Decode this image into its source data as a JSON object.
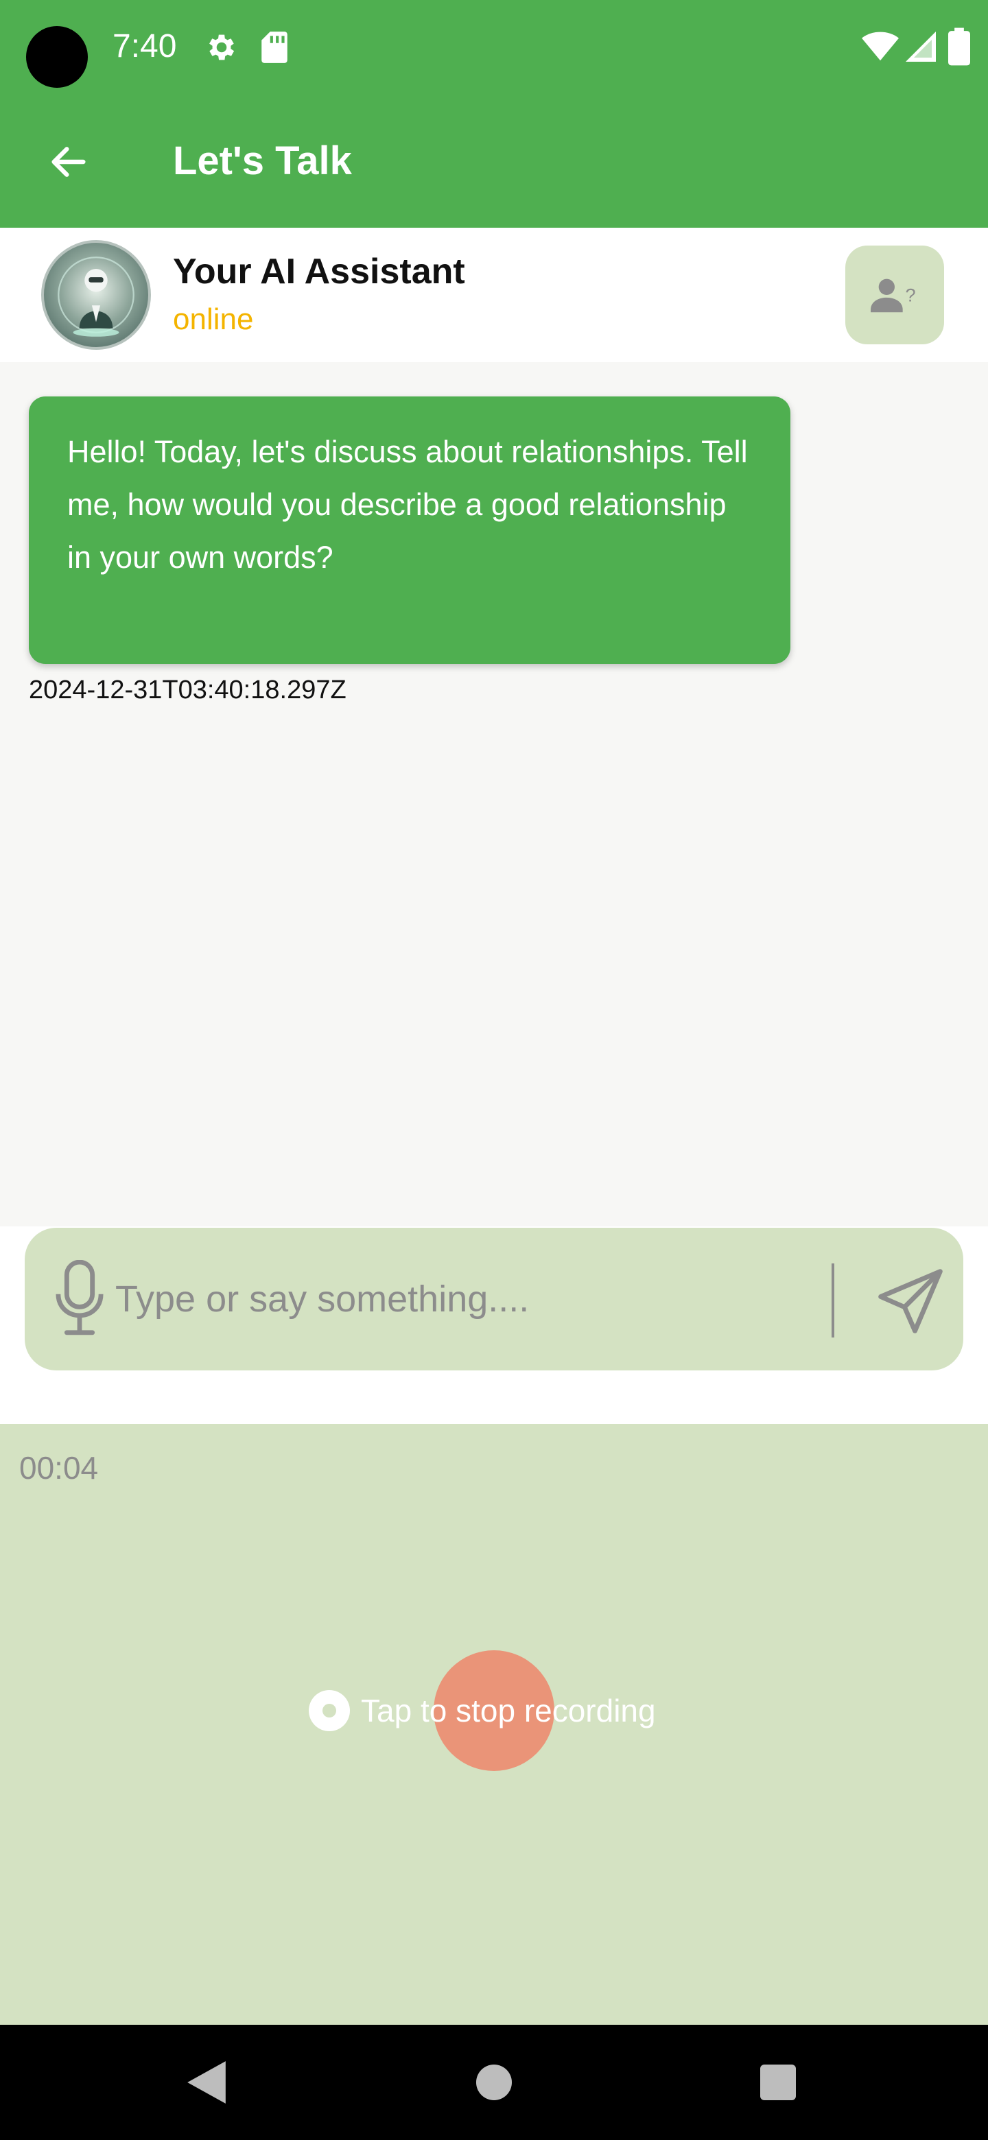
{
  "status_bar": {
    "time": "7:40",
    "icons": [
      "gear-icon",
      "sd-card-icon",
      "wifi-icon",
      "cell-signal-icon",
      "battery-icon"
    ]
  },
  "app_bar": {
    "title": "Let's Talk",
    "back_icon": "arrow-left-icon"
  },
  "chat_header": {
    "name": "Your AI Assistant",
    "status": "online",
    "profile_icon": "person-question-icon"
  },
  "messages": [
    {
      "text": "Hello! Today, let's discuss about relationships. Tell me, how would you describe a good relationship in your own words?",
      "timestamp": "2024-12-31T03:40:18.297Z"
    }
  ],
  "composer": {
    "placeholder": "Type or say something....",
    "value": "",
    "mic_icon": "microphone-icon",
    "send_icon": "send-icon"
  },
  "recording": {
    "timer": "00:04",
    "label": "Tap to stop recording"
  },
  "colors": {
    "primary_green": "#4FAF50",
    "light_green": "#D4E2C2",
    "status_yellow": "#F4B400",
    "stop_button": "#EA9478",
    "background": "#F7F7F5"
  }
}
